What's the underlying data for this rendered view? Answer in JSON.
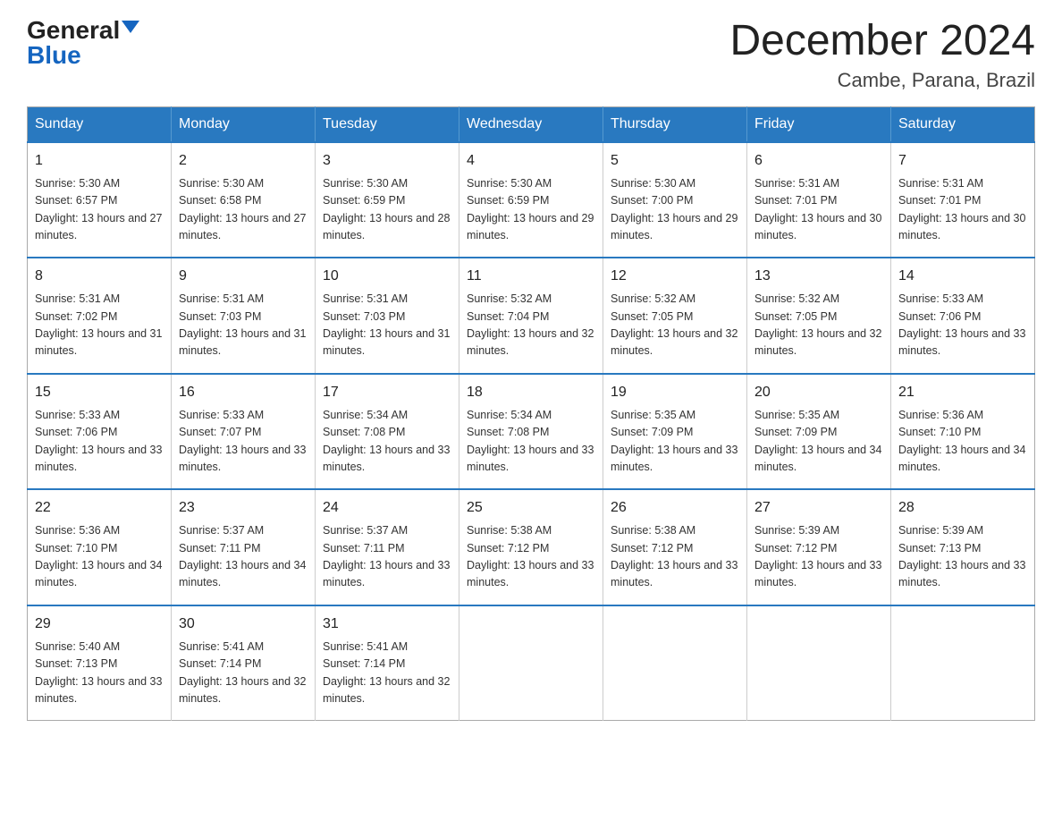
{
  "header": {
    "logo": {
      "general": "General",
      "blue": "Blue"
    },
    "title": "December 2024",
    "location": "Cambe, Parana, Brazil"
  },
  "calendar": {
    "days_of_week": [
      "Sunday",
      "Monday",
      "Tuesday",
      "Wednesday",
      "Thursday",
      "Friday",
      "Saturday"
    ],
    "weeks": [
      [
        {
          "day": 1,
          "sunrise": "5:30 AM",
          "sunset": "6:57 PM",
          "daylight": "13 hours and 27 minutes."
        },
        {
          "day": 2,
          "sunrise": "5:30 AM",
          "sunset": "6:58 PM",
          "daylight": "13 hours and 27 minutes."
        },
        {
          "day": 3,
          "sunrise": "5:30 AM",
          "sunset": "6:59 PM",
          "daylight": "13 hours and 28 minutes."
        },
        {
          "day": 4,
          "sunrise": "5:30 AM",
          "sunset": "6:59 PM",
          "daylight": "13 hours and 29 minutes."
        },
        {
          "day": 5,
          "sunrise": "5:30 AM",
          "sunset": "7:00 PM",
          "daylight": "13 hours and 29 minutes."
        },
        {
          "day": 6,
          "sunrise": "5:31 AM",
          "sunset": "7:01 PM",
          "daylight": "13 hours and 30 minutes."
        },
        {
          "day": 7,
          "sunrise": "5:31 AM",
          "sunset": "7:01 PM",
          "daylight": "13 hours and 30 minutes."
        }
      ],
      [
        {
          "day": 8,
          "sunrise": "5:31 AM",
          "sunset": "7:02 PM",
          "daylight": "13 hours and 31 minutes."
        },
        {
          "day": 9,
          "sunrise": "5:31 AM",
          "sunset": "7:03 PM",
          "daylight": "13 hours and 31 minutes."
        },
        {
          "day": 10,
          "sunrise": "5:31 AM",
          "sunset": "7:03 PM",
          "daylight": "13 hours and 31 minutes."
        },
        {
          "day": 11,
          "sunrise": "5:32 AM",
          "sunset": "7:04 PM",
          "daylight": "13 hours and 32 minutes."
        },
        {
          "day": 12,
          "sunrise": "5:32 AM",
          "sunset": "7:05 PM",
          "daylight": "13 hours and 32 minutes."
        },
        {
          "day": 13,
          "sunrise": "5:32 AM",
          "sunset": "7:05 PM",
          "daylight": "13 hours and 32 minutes."
        },
        {
          "day": 14,
          "sunrise": "5:33 AM",
          "sunset": "7:06 PM",
          "daylight": "13 hours and 33 minutes."
        }
      ],
      [
        {
          "day": 15,
          "sunrise": "5:33 AM",
          "sunset": "7:06 PM",
          "daylight": "13 hours and 33 minutes."
        },
        {
          "day": 16,
          "sunrise": "5:33 AM",
          "sunset": "7:07 PM",
          "daylight": "13 hours and 33 minutes."
        },
        {
          "day": 17,
          "sunrise": "5:34 AM",
          "sunset": "7:08 PM",
          "daylight": "13 hours and 33 minutes."
        },
        {
          "day": 18,
          "sunrise": "5:34 AM",
          "sunset": "7:08 PM",
          "daylight": "13 hours and 33 minutes."
        },
        {
          "day": 19,
          "sunrise": "5:35 AM",
          "sunset": "7:09 PM",
          "daylight": "13 hours and 33 minutes."
        },
        {
          "day": 20,
          "sunrise": "5:35 AM",
          "sunset": "7:09 PM",
          "daylight": "13 hours and 34 minutes."
        },
        {
          "day": 21,
          "sunrise": "5:36 AM",
          "sunset": "7:10 PM",
          "daylight": "13 hours and 34 minutes."
        }
      ],
      [
        {
          "day": 22,
          "sunrise": "5:36 AM",
          "sunset": "7:10 PM",
          "daylight": "13 hours and 34 minutes."
        },
        {
          "day": 23,
          "sunrise": "5:37 AM",
          "sunset": "7:11 PM",
          "daylight": "13 hours and 34 minutes."
        },
        {
          "day": 24,
          "sunrise": "5:37 AM",
          "sunset": "7:11 PM",
          "daylight": "13 hours and 33 minutes."
        },
        {
          "day": 25,
          "sunrise": "5:38 AM",
          "sunset": "7:12 PM",
          "daylight": "13 hours and 33 minutes."
        },
        {
          "day": 26,
          "sunrise": "5:38 AM",
          "sunset": "7:12 PM",
          "daylight": "13 hours and 33 minutes."
        },
        {
          "day": 27,
          "sunrise": "5:39 AM",
          "sunset": "7:12 PM",
          "daylight": "13 hours and 33 minutes."
        },
        {
          "day": 28,
          "sunrise": "5:39 AM",
          "sunset": "7:13 PM",
          "daylight": "13 hours and 33 minutes."
        }
      ],
      [
        {
          "day": 29,
          "sunrise": "5:40 AM",
          "sunset": "7:13 PM",
          "daylight": "13 hours and 33 minutes."
        },
        {
          "day": 30,
          "sunrise": "5:41 AM",
          "sunset": "7:14 PM",
          "daylight": "13 hours and 32 minutes."
        },
        {
          "day": 31,
          "sunrise": "5:41 AM",
          "sunset": "7:14 PM",
          "daylight": "13 hours and 32 minutes."
        },
        null,
        null,
        null,
        null
      ]
    ]
  }
}
